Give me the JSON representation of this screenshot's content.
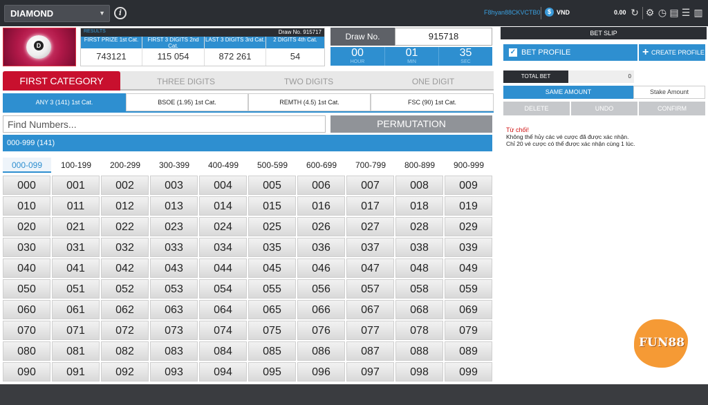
{
  "topbar": {
    "game": "DIAMOND",
    "username": "F8hyan88CKVCTB0",
    "currency": "VND",
    "balance": "0.00"
  },
  "logo": {
    "letter": "D"
  },
  "results": {
    "label": "RESULTS",
    "draw_no": "Draw No. 915717",
    "columns": [
      {
        "title": "FIRST PRIZE 1st Cat.",
        "value": "743121"
      },
      {
        "title": "FIRST 3 DIGITS 2nd Cat.",
        "value": "115   054"
      },
      {
        "title": "LAST 3 DIGITS 3rd Cat.",
        "value": "872   261"
      },
      {
        "title": "2 DIGITS 4th Cat.",
        "value": "54"
      }
    ]
  },
  "draw": {
    "label": "Draw No.",
    "number": "915718",
    "countdown": [
      {
        "value": "00",
        "unit": "HOUR"
      },
      {
        "value": "01",
        "unit": "MIN"
      },
      {
        "value": "35",
        "unit": "SEC"
      }
    ]
  },
  "category_tabs": [
    "FIRST CATEGORY",
    "THREE DIGITS",
    "TWO DIGITS",
    "ONE DIGIT"
  ],
  "sub_tabs": [
    "ANY 3 (141) 1st Cat.",
    "BSOE (1.95) 1st Cat.",
    "REMTH (4.5) 1st Cat.",
    "FSC (90) 1st Cat."
  ],
  "search": {
    "placeholder": "Find Numbers...",
    "permutation": "PERMUTATION"
  },
  "range_bar": "000-999 (141)",
  "range_tabs": [
    "000-099",
    "100-199",
    "200-299",
    "300-399",
    "400-499",
    "500-599",
    "600-699",
    "700-799",
    "800-899",
    "900-999"
  ],
  "numbers": [
    "000",
    "001",
    "002",
    "003",
    "004",
    "005",
    "006",
    "007",
    "008",
    "009",
    "010",
    "011",
    "012",
    "013",
    "014",
    "015",
    "016",
    "017",
    "018",
    "019",
    "020",
    "021",
    "022",
    "023",
    "024",
    "025",
    "026",
    "027",
    "028",
    "029",
    "030",
    "031",
    "032",
    "033",
    "034",
    "035",
    "036",
    "037",
    "038",
    "039",
    "040",
    "041",
    "042",
    "043",
    "044",
    "045",
    "046",
    "047",
    "048",
    "049",
    "050",
    "051",
    "052",
    "053",
    "054",
    "055",
    "056",
    "057",
    "058",
    "059",
    "060",
    "061",
    "062",
    "063",
    "064",
    "065",
    "066",
    "067",
    "068",
    "069",
    "070",
    "071",
    "072",
    "073",
    "074",
    "075",
    "076",
    "077",
    "078",
    "079",
    "080",
    "081",
    "082",
    "083",
    "084",
    "085",
    "086",
    "087",
    "088",
    "089",
    "090",
    "091",
    "092",
    "093",
    "094",
    "095",
    "096",
    "097",
    "098",
    "099"
  ],
  "slip": {
    "header": "BET SLIP",
    "bet_profile": "BET PROFILE",
    "create_profile": "CREATE PROFILE",
    "total_bet_label": "TOTAL BET",
    "total_bet_value": "0",
    "same_amount": "SAME AMOUNT",
    "stake_amount": "Stake Amount",
    "delete": "DELETE",
    "undo": "UNDO",
    "confirm": "CONFIRM",
    "msg_title": "Từ chối!",
    "msg_line1": "Không thể hủy các vé cược đã được xác nhận.",
    "msg_line2": "Chỉ 20 vé cược có thể được xác nhận cùng 1 lúc."
  },
  "brand": "FUN88",
  "colors": {
    "accent": "#2e8fd0",
    "active_category": "#c8102e",
    "dark": "#2b2e33"
  }
}
